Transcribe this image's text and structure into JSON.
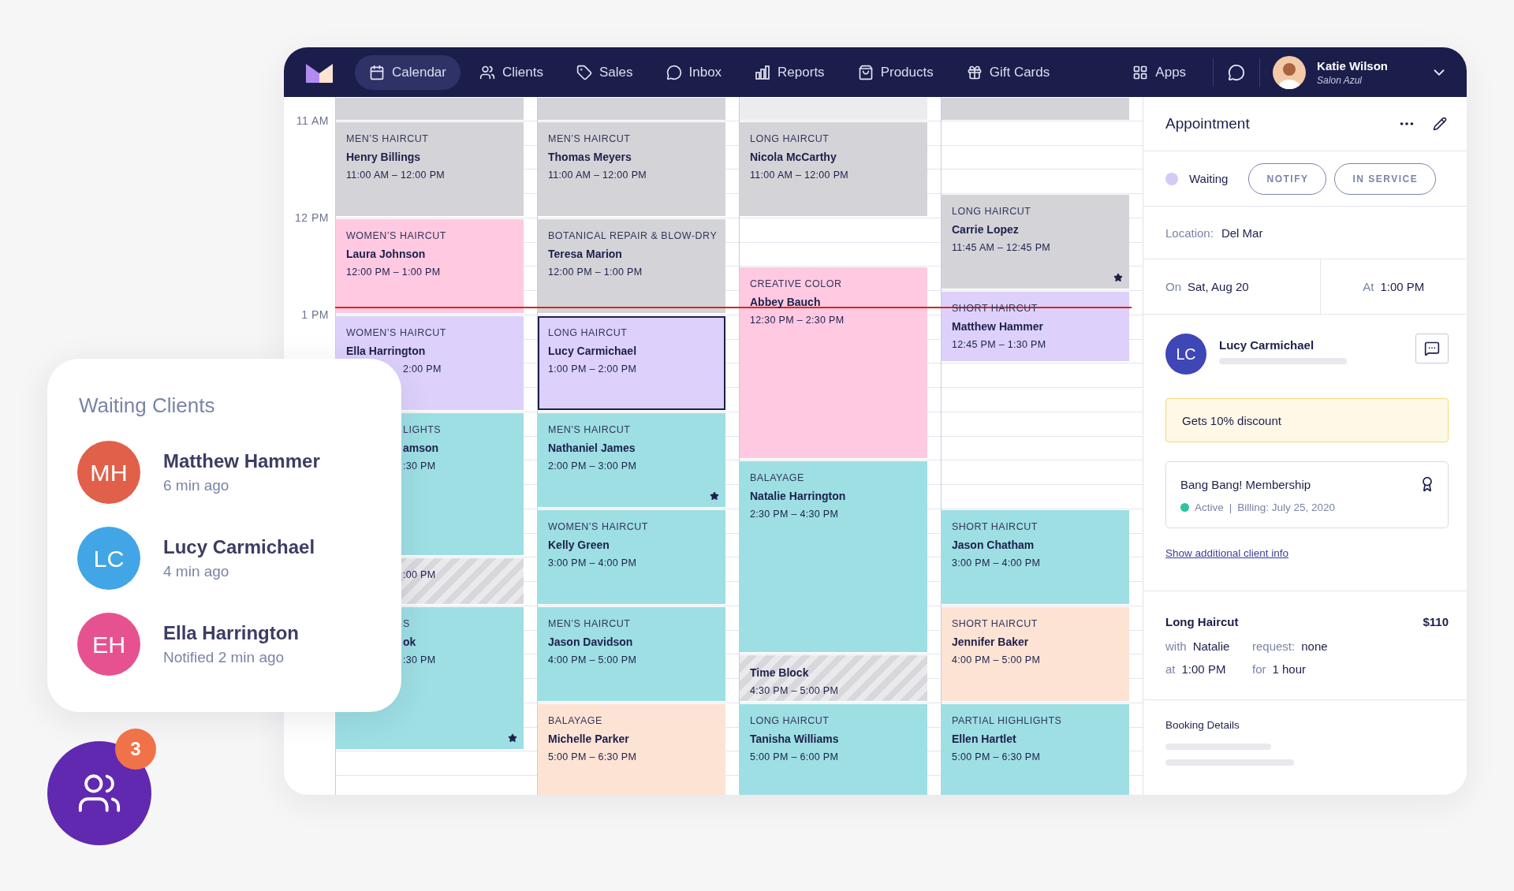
{
  "nav": {
    "tabs": [
      {
        "label": "Calendar",
        "selected": true
      },
      {
        "label": "Clients",
        "selected": false
      },
      {
        "label": "Sales",
        "selected": false
      },
      {
        "label": "Inbox",
        "selected": false
      },
      {
        "label": "Reports",
        "selected": false
      },
      {
        "label": "Products",
        "selected": false
      },
      {
        "label": "Gift Cards",
        "selected": false
      }
    ],
    "apps": "Apps",
    "user": {
      "name": "Katie Wilson",
      "subtitle": "Salon Azul"
    }
  },
  "calendar": {
    "hours": [
      "11 AM",
      "12 PM",
      "1 PM"
    ],
    "columns": [
      {
        "events": [
          {
            "kind": "blank",
            "color": "#d4d4d8",
            "selected": false,
            "starred": false
          },
          {
            "kind": "appointment",
            "service": "MEN’S HAIRCUT",
            "client": "Henry Billings",
            "time": "11:00 AM – 12:00 PM",
            "color": "#d4d4d8",
            "selected": false,
            "starred": false
          },
          {
            "kind": "appointment",
            "service": "WOMEN’S HAIRCUT",
            "client": "Laura Johnson",
            "time": "12:00 PM – 1:00 PM",
            "color": "#ffc9e1",
            "selected": false,
            "starred": false
          },
          {
            "kind": "appointment",
            "service": "WOMEN’S HAIRCUT",
            "client": "Ella Harrington",
            "time": "2:00 PM",
            "color": "#ddd1fb",
            "selected": false,
            "starred": false
          },
          {
            "kind": "appointment",
            "service": "LIGHTS",
            "client": "amson",
            "time": ":30 PM",
            "color": "#9ddfe3",
            "selected": false,
            "starred": false
          },
          {
            "kind": "block",
            "time": ":00 PM",
            "color": "#d8d8dc",
            "selected": false,
            "starred": false
          },
          {
            "kind": "appointment",
            "service": "S",
            "client": "ok",
            "time": ":30 PM",
            "color": "#9ddfe3",
            "selected": false,
            "starred": true
          }
        ]
      },
      {
        "events": [
          {
            "kind": "blank",
            "color": "#d4d4d8",
            "selected": false,
            "starred": false
          },
          {
            "kind": "appointment",
            "service": "MEN’S HAIRCUT",
            "client": "Thomas Meyers",
            "time": "11:00 AM – 12:00 PM",
            "color": "#d4d4d8",
            "selected": false,
            "starred": false
          },
          {
            "kind": "appointment",
            "service": "BOTANICAL REPAIR & BLOW-DRY",
            "client": "Teresa Marion",
            "time": "12:00 PM – 1:00 PM",
            "color": "#d4d4d8",
            "selected": false,
            "starred": false
          },
          {
            "kind": "appointment",
            "service": "LONG HAIRCUT",
            "client": "Lucy Carmichael",
            "time": "1:00 PM – 2:00 PM",
            "color": "#ddd1fb",
            "selected": true,
            "starred": false
          },
          {
            "kind": "appointment",
            "service": "MEN’S HAIRCUT",
            "client": "Nathaniel James",
            "time": "2:00 PM – 3:00 PM",
            "color": "#9ddfe3",
            "selected": false,
            "starred": true
          },
          {
            "kind": "appointment",
            "service": "WOMEN’S HAIRCUT",
            "client": "Kelly Green",
            "time": "3:00 PM – 4:00 PM",
            "color": "#9ddfe3",
            "selected": false,
            "starred": false
          },
          {
            "kind": "appointment",
            "service": "MEN’S HAIRCUT",
            "client": "Jason Davidson",
            "time": "4:00 PM – 5:00 PM",
            "color": "#9ddfe3",
            "selected": false,
            "starred": false
          },
          {
            "kind": "appointment",
            "service": "BALAYAGE",
            "client": "Michelle Parker",
            "time": "5:00 PM – 6:30 PM",
            "color": "#fde3d4",
            "selected": false,
            "starred": false
          }
        ]
      },
      {
        "events": [
          {
            "kind": "blank",
            "color": "#ececee",
            "selected": false,
            "starred": false
          },
          {
            "kind": "appointment",
            "service": "LONG HAIRCUT",
            "client": "Nicola McCarthy",
            "time": "11:00 AM – 12:00 PM",
            "color": "#d4d4d8",
            "selected": false,
            "starred": false
          },
          {
            "kind": "appointment",
            "service": "CREATIVE COLOR",
            "client": "Abbey Bauch",
            "time": "12:30 PM – 2:30 PM",
            "color": "#ffc9e1",
            "selected": false,
            "starred": false
          },
          {
            "kind": "appointment",
            "service": "BALAYAGE",
            "client": "Natalie Harrington",
            "time": "2:30 PM – 4:30 PM",
            "color": "#9ddfe3",
            "selected": false,
            "starred": false
          },
          {
            "kind": "block",
            "client": "Time Block",
            "time": "4:30 PM – 5:00 PM",
            "color": "#d8d8dc",
            "selected": false,
            "starred": false
          },
          {
            "kind": "appointment",
            "service": "LONG HAIRCUT",
            "client": "Tanisha Williams",
            "time": "5:00 PM – 6:00 PM",
            "color": "#9ddfe3",
            "selected": false,
            "starred": false
          }
        ]
      },
      {
        "events": [
          {
            "kind": "blank",
            "color": "#d4d4d8",
            "selected": false,
            "starred": false
          },
          {
            "kind": "appointment",
            "service": "LONG HAIRCUT",
            "client": "Carrie Lopez",
            "time": "11:45 AM – 12:45 PM",
            "color": "#d4d4d8",
            "selected": false,
            "starred": true
          },
          {
            "kind": "appointment",
            "service": "SHORT HAIRCUT",
            "client": "Matthew Hammer",
            "time": "12:45 PM – 1:30 PM",
            "color": "#ddd1fb",
            "selected": false,
            "starred": false
          },
          {
            "kind": "appointment",
            "service": "SHORT HAIRCUT",
            "client": "Jason Chatham",
            "time": "3:00 PM – 4:00 PM",
            "color": "#9ddfe3",
            "selected": false,
            "starred": false
          },
          {
            "kind": "appointment",
            "service": "SHORT HAIRCUT",
            "client": "Jennifer Baker",
            "time": "4:00 PM – 5:00 PM",
            "color": "#fde3d4",
            "selected": false,
            "starred": false
          },
          {
            "kind": "appointment",
            "service": "PARTIAL HIGHLIGHTS",
            "client": "Ellen Hartlet",
            "time": "5:00 PM – 6:30 PM",
            "color": "#9ddfe3",
            "selected": false,
            "starred": false
          }
        ]
      }
    ]
  },
  "appointment": {
    "title": "Appointment",
    "status": "Waiting",
    "actions": [
      "NOTIFY",
      "IN SERVICE"
    ],
    "location": {
      "label": "Location:",
      "value": "Del Mar"
    },
    "date": {
      "label": "On",
      "value": "Sat, Aug 20"
    },
    "time": {
      "label": "At",
      "value": "1:00 PM"
    },
    "client": {
      "initials": "LC",
      "name": "Lucy Carmichael"
    },
    "note": "Gets 10% discount",
    "membership": {
      "name": "Bang Bang! Membership",
      "status": "Active",
      "separator": "|",
      "billing": "Billing: July 25, 2020"
    },
    "link": "Show additional client info",
    "service": {
      "name": "Long Haircut",
      "price": "$110",
      "details": [
        {
          "label": "with",
          "value": "Natalie"
        },
        {
          "label": "request:",
          "value": "none"
        },
        {
          "label": "at",
          "value": "1:00 PM"
        },
        {
          "label": "for",
          "value": "1 hour"
        }
      ]
    },
    "booking": {
      "title": "Booking Details"
    }
  },
  "waiting": {
    "title": "Waiting Clients",
    "clients": [
      {
        "initials": "MH",
        "name": "Matthew Hammer",
        "time": "6 min ago",
        "color": "#e0604a"
      },
      {
        "initials": "LC",
        "name": "Lucy Carmichael",
        "time": "4 min ago",
        "color": "#42a5e5"
      },
      {
        "initials": "EH",
        "name": "Ella Harrington",
        "time": "Notified 2 min ago",
        "color": "#e6528f"
      }
    ]
  },
  "waiting_button": {
    "count": "3"
  }
}
